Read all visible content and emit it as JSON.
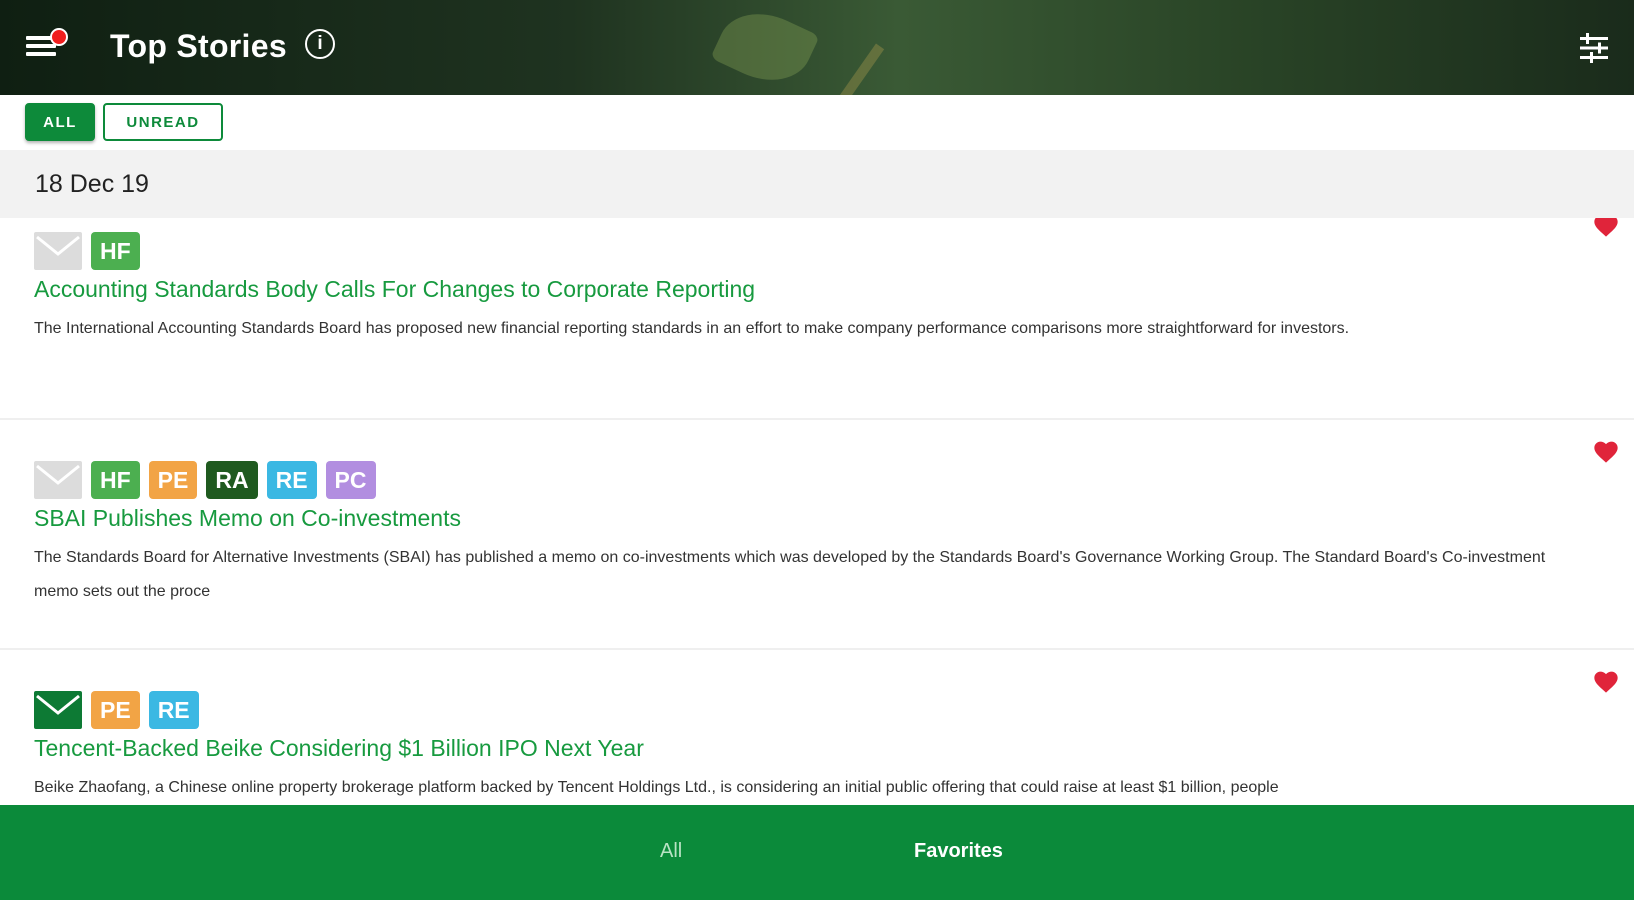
{
  "header": {
    "title": "Top Stories",
    "menu_icon": "hamburger-menu-icon",
    "info_icon": "info-icon",
    "info_glyph": "i",
    "settings_icon": "tune-icon",
    "notification_color": "#f01e1e"
  },
  "filters": {
    "all_label": "ALL",
    "unread_label": "UNREAD",
    "accent": "#0d8a3a"
  },
  "date_header": "18 Dec 19",
  "stories": [
    {
      "mail_icon": "envelope-read-icon",
      "tags": [
        "HF"
      ],
      "title": "Accounting Standards Body Calls For Changes to Corporate Reporting",
      "body": "The International Accounting Standards Board has proposed new financial reporting standards in an effort to make company performance comparisons more straightforward for investors.",
      "favorite": true
    },
    {
      "mail_icon": "envelope-read-icon",
      "tags": [
        "HF",
        "PE",
        "RA",
        "RE",
        "PC"
      ],
      "title": "SBAI Publishes Memo on Co-investments",
      "body": "The Standards Board for Alternative Investments (SBAI) has published a memo on co-investments which was developed by the Standards Board's Governance Working Group. The Standard Board's Co-investment memo sets out the proce",
      "favorite": true
    },
    {
      "mail_icon": "envelope-unread-icon",
      "tags": [
        "PE",
        "RE"
      ],
      "title": "Tencent-Backed Beike Considering $1 Billion IPO Next Year",
      "body": "Beike Zhaofang, a Chinese online property brokerage platform backed by Tencent Holdings Ltd., is considering an initial public offering that could raise at least $1 billion, people",
      "favorite": true
    }
  ],
  "tag_colors": {
    "HF": "#4caf50",
    "PE": "#f2a445",
    "RA": "#1f5a1f",
    "RE": "#3bb8e3",
    "PC": "#b28ee0"
  },
  "bottom_tabs": {
    "all_label": "All",
    "favorites_label": "Favorites"
  },
  "colors": {
    "title_green": "#179a3f",
    "heart_red": "#e0243a",
    "bottom_bar": "#0b8a3a"
  }
}
